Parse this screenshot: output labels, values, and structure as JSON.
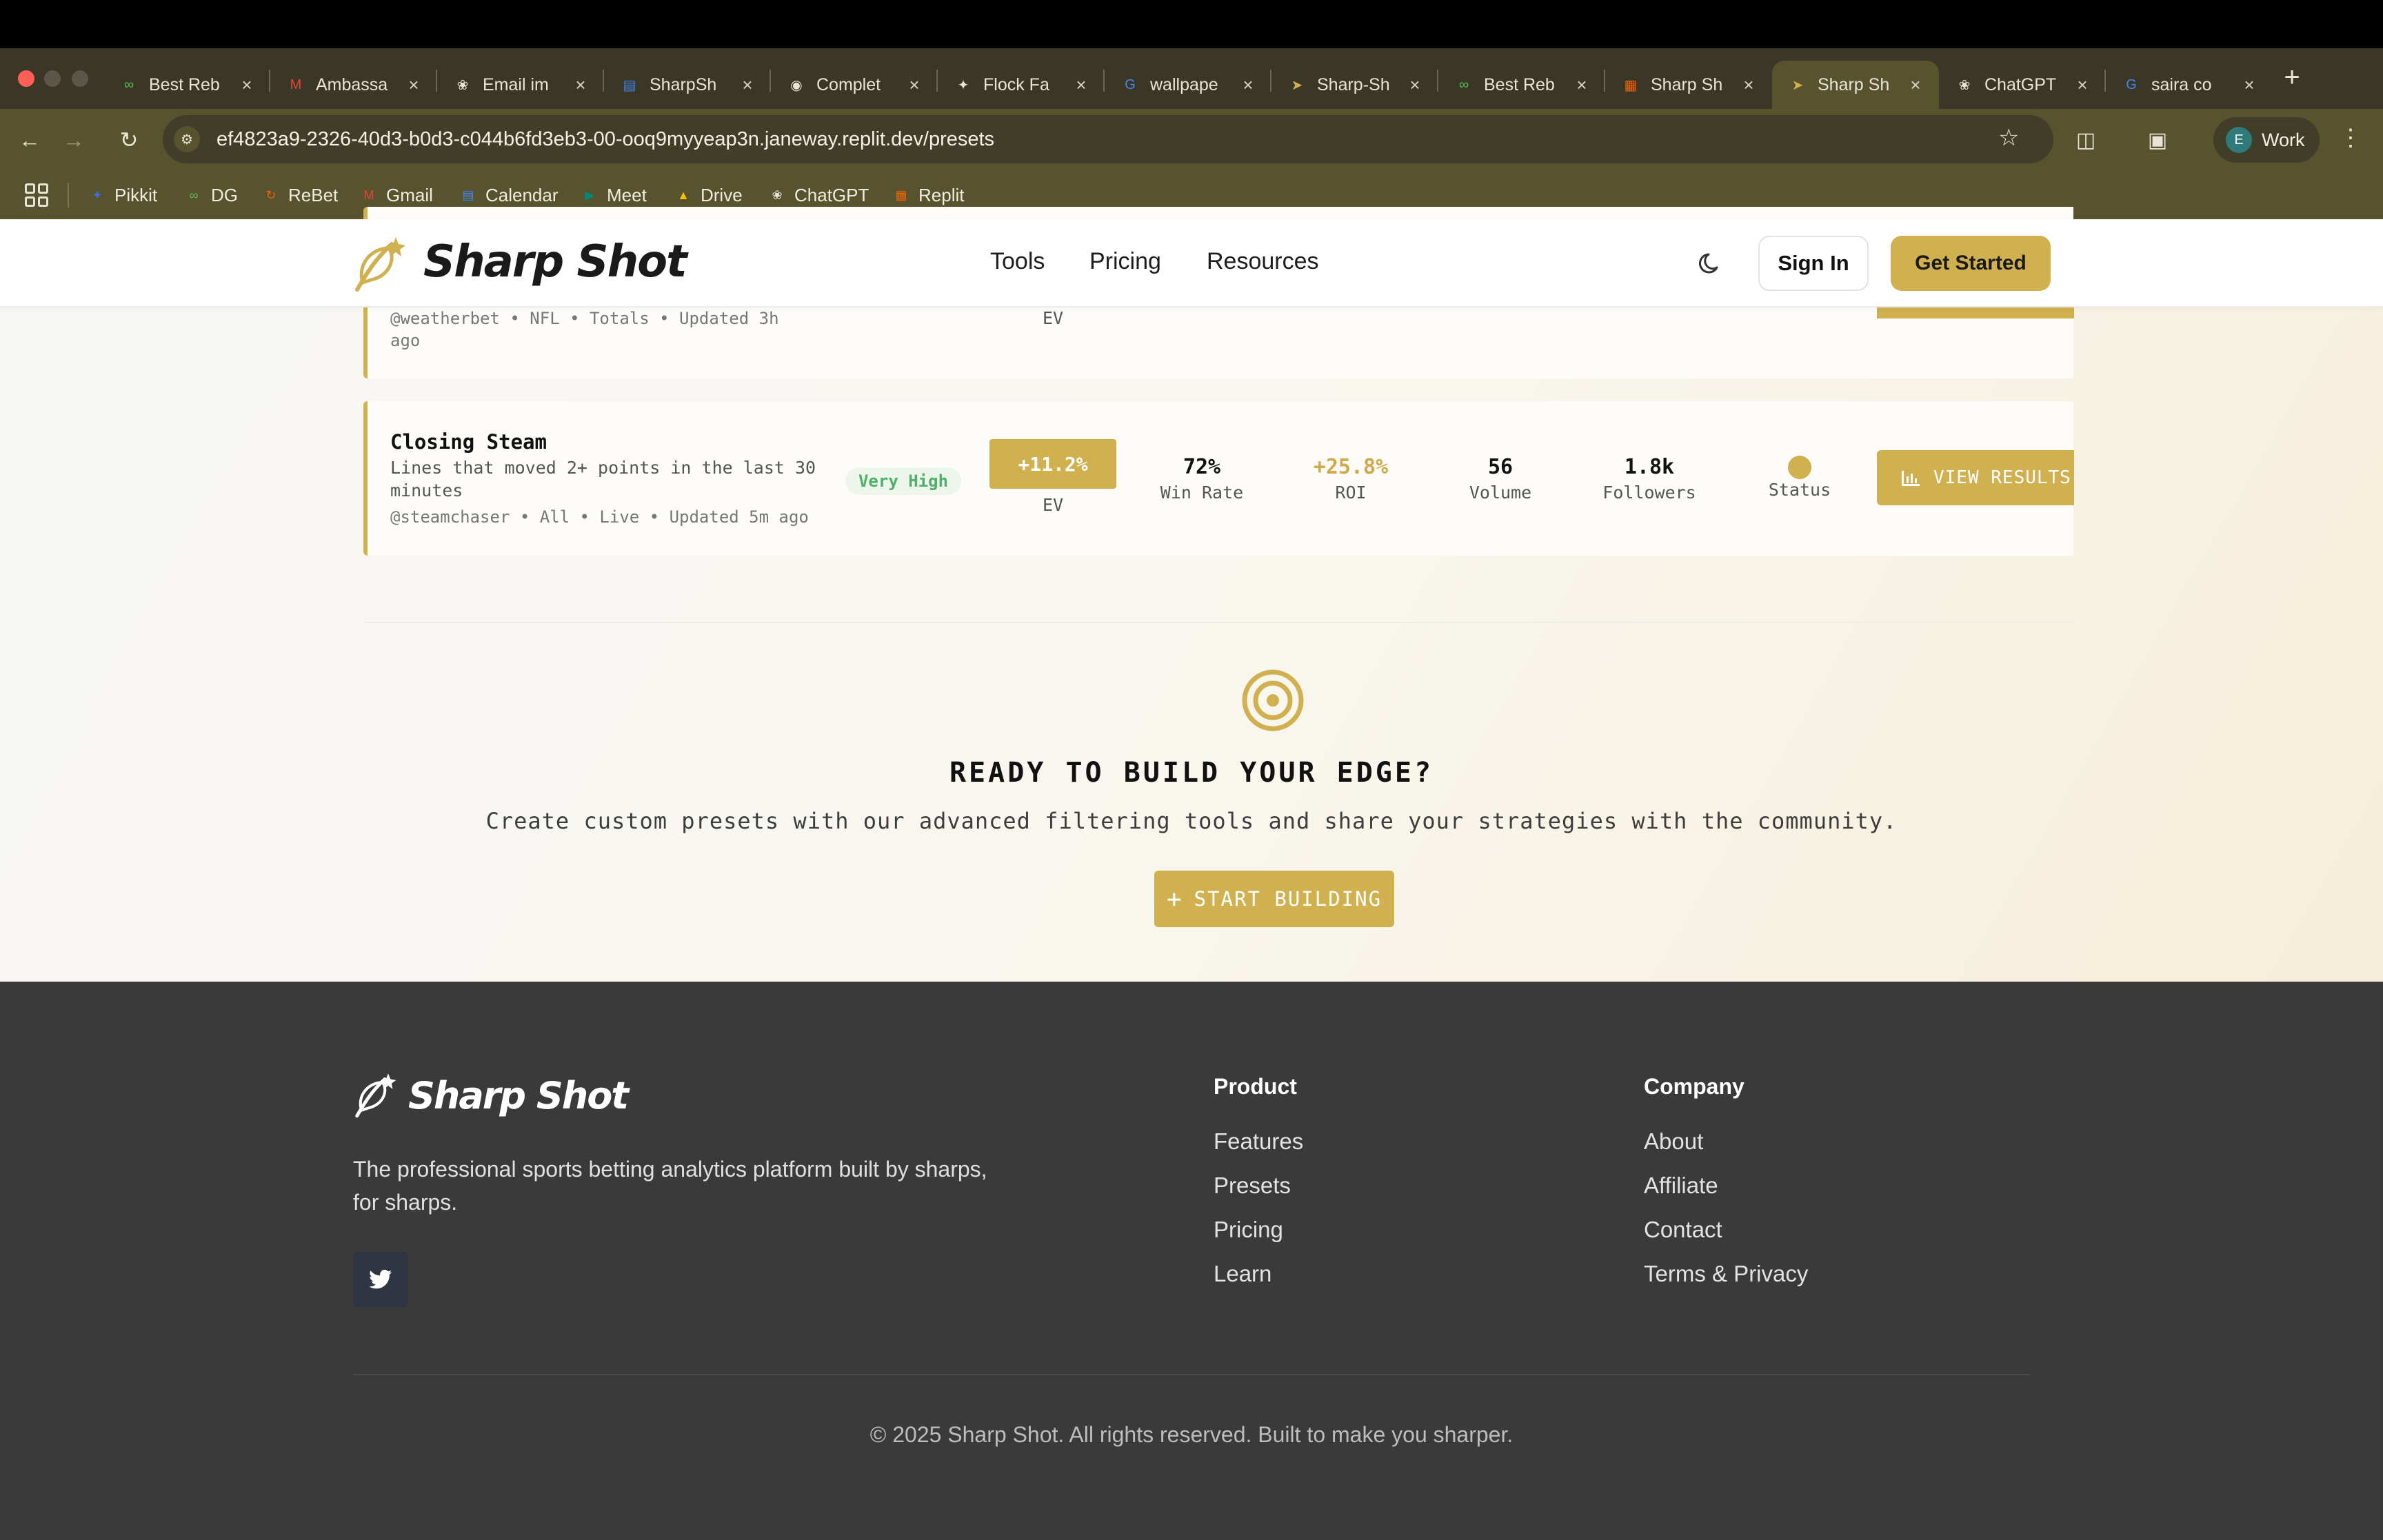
{
  "browser": {
    "tabs": [
      {
        "title": "Best Reb",
        "icon": "rebet-favicon",
        "color": "#5bbd4a"
      },
      {
        "title": "Ambassa",
        "icon": "gmail-favicon",
        "color": "#ea4335"
      },
      {
        "title": "Email im",
        "icon": "openai-favicon",
        "color": "#e8e4d6"
      },
      {
        "title": "SharpSh",
        "icon": "google-docs-favicon",
        "color": "#4285f4"
      },
      {
        "title": "Complet",
        "icon": "github-favicon",
        "color": "#e8e4d6"
      },
      {
        "title": "Flock Fa",
        "icon": "flock-favicon",
        "color": "#e8e4d6"
      },
      {
        "title": "wallpape",
        "icon": "google-favicon",
        "color": "#4285f4"
      },
      {
        "title": "Sharp-Sh",
        "icon": "sharpshot-favicon",
        "color": "#d1b14f"
      },
      {
        "title": "Best Reb",
        "icon": "rebet-favicon",
        "color": "#5bbd4a"
      },
      {
        "title": "Sharp Sh",
        "icon": "replit-favicon",
        "color": "#f26207"
      },
      {
        "title": "Sharp Sh",
        "icon": "sharpshot-favicon",
        "color": "#d1b14f",
        "active": true
      },
      {
        "title": "ChatGPT",
        "icon": "openai-favicon",
        "color": "#e8e4d6"
      },
      {
        "title": "saira co",
        "icon": "google-favicon",
        "color": "#4285f4"
      }
    ],
    "new_tab": "+",
    "url": "ef4823a9-2326-40d3-b0d3-c044b6fd3eb3-00-ooq9myyeap3n.janeway.replit.dev/presets",
    "profile": {
      "initial": "E",
      "label": "Work"
    },
    "bookmarks": [
      {
        "label": "Pikkit",
        "icon": "pikkit-icon",
        "color": "#3b6fe0"
      },
      {
        "label": "DG",
        "icon": "dg-icon",
        "color": "#5bbd4a"
      },
      {
        "label": "ReBet",
        "icon": "rebet-icon",
        "color": "#f26207"
      },
      {
        "label": "Gmail",
        "icon": "gmail-icon",
        "color": "#ea4335"
      },
      {
        "label": "Calendar",
        "icon": "calendar-icon",
        "color": "#4285f4"
      },
      {
        "label": "Meet",
        "icon": "meet-icon",
        "color": "#00897b"
      },
      {
        "label": "Drive",
        "icon": "drive-icon",
        "color": "#fbbc04"
      },
      {
        "label": "ChatGPT",
        "icon": "openai-icon",
        "color": "#e8e4d6"
      },
      {
        "label": "Replit",
        "icon": "replit-icon",
        "color": "#f26207"
      }
    ]
  },
  "header": {
    "brand": "Sharp Shot",
    "nav": [
      "Tools",
      "Pricing",
      "Resources"
    ],
    "signin": "Sign In",
    "get_started": "Get Started"
  },
  "presets": {
    "partial": {
      "meta_line1": "@weatherbet • NFL • Totals • Updated 3h",
      "meta_line2": "ago",
      "ev_label": "EV"
    },
    "closing_steam": {
      "title": "Closing Steam",
      "description": "Lines that moved 2+ points in the last 30 minutes",
      "meta": "@steamchaser • All • Live • Updated 5m ago",
      "risk": "Very High",
      "ev": "+11.2%",
      "ev_label": "EV",
      "win_rate": "72%",
      "win_rate_label": "Win Rate",
      "roi": "+25.8%",
      "roi_label": "ROI",
      "volume": "56",
      "volume_label": "Volume",
      "followers": "1.8k",
      "followers_label": "Followers",
      "status_label": "Status",
      "view_results": "VIEW RESULTS"
    }
  },
  "cta": {
    "title": "READY TO BUILD YOUR EDGE?",
    "subtitle": "Create custom presets with our advanced filtering tools and share your strategies with the community.",
    "button": "START BUILDING",
    "button_icon": "+"
  },
  "footer": {
    "brand": "Sharp Shot",
    "tagline": "The professional sports betting analytics platform built by sharps, for sharps.",
    "product_heading": "Product",
    "product_links": [
      "Features",
      "Presets",
      "Pricing",
      "Learn"
    ],
    "company_heading": "Company",
    "company_links": [
      "About",
      "Affiliate",
      "Contact",
      "Terms & Privacy"
    ],
    "copyright": "© 2025 Sharp Shot. All rights reserved. Built to make you sharper."
  },
  "colors": {
    "accent_gold": "#d1b14f",
    "risk_green": "#4fb06c",
    "footer_bg": "#3a3a3a",
    "chrome_bg": "#57532f"
  }
}
